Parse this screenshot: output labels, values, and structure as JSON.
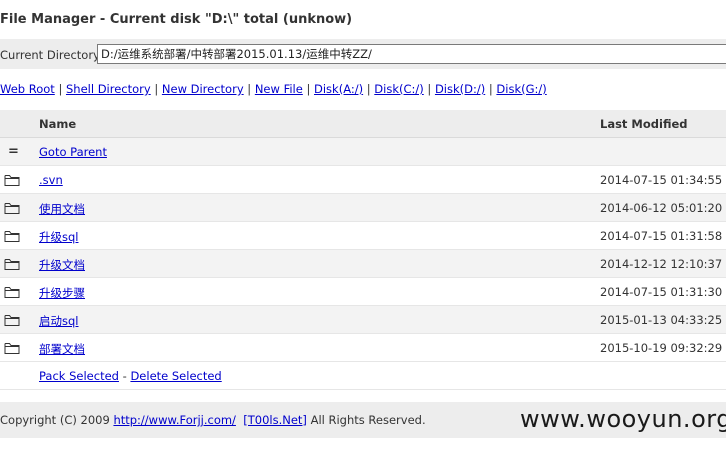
{
  "page_title": "File Manager - Current disk \"D:\\\" total (unknow)",
  "current_directory": {
    "label": "Current Directory",
    "value": "D:/运维系统部署/中转部署2015.01.13/运维中转ZZ/"
  },
  "nav_links": [
    "Web Root",
    "Shell Directory",
    "New Directory",
    "New File",
    "Disk(A:/)",
    "Disk(C:/)",
    "Disk(D:/)",
    "Disk(G:/)"
  ],
  "table": {
    "headers": {
      "name": "Name",
      "last_modified": "Last Modified"
    },
    "parent_icon": "=",
    "parent_label": "Goto Parent",
    "rows": [
      {
        "icon": "folder-icon",
        "name": ".svn",
        "modified": "2014-07-15 01:34:55"
      },
      {
        "icon": "folder-icon",
        "name": "使用文档",
        "modified": "2014-06-12 05:01:20"
      },
      {
        "icon": "folder-icon",
        "name": "升级sql",
        "modified": "2014-07-15 01:31:58"
      },
      {
        "icon": "folder-icon",
        "name": "升级文档",
        "modified": "2014-12-12 12:10:37"
      },
      {
        "icon": "folder-icon",
        "name": "升级步骤",
        "modified": "2014-07-15 01:31:30"
      },
      {
        "icon": "folder-icon",
        "name": "启动sql",
        "modified": "2015-01-13 04:33:25"
      },
      {
        "icon": "folder-icon",
        "name": "部署文档",
        "modified": "2015-10-19 09:32:29"
      }
    ],
    "actions": {
      "pack": "Pack Selected",
      "separator": " - ",
      "delete": "Delete Selected"
    }
  },
  "footer": {
    "prefix": "Copyright (C) 2009 ",
    "link1": "http://www.Forjj.com/",
    "link2": "[T00ls.Net]",
    "suffix": " All Rights Reserved."
  },
  "watermark": "www.wooyun.org",
  "colors": {
    "link": "#0000cc",
    "bar_bg": "#ededed",
    "alt_row": "#f3f3f3"
  }
}
